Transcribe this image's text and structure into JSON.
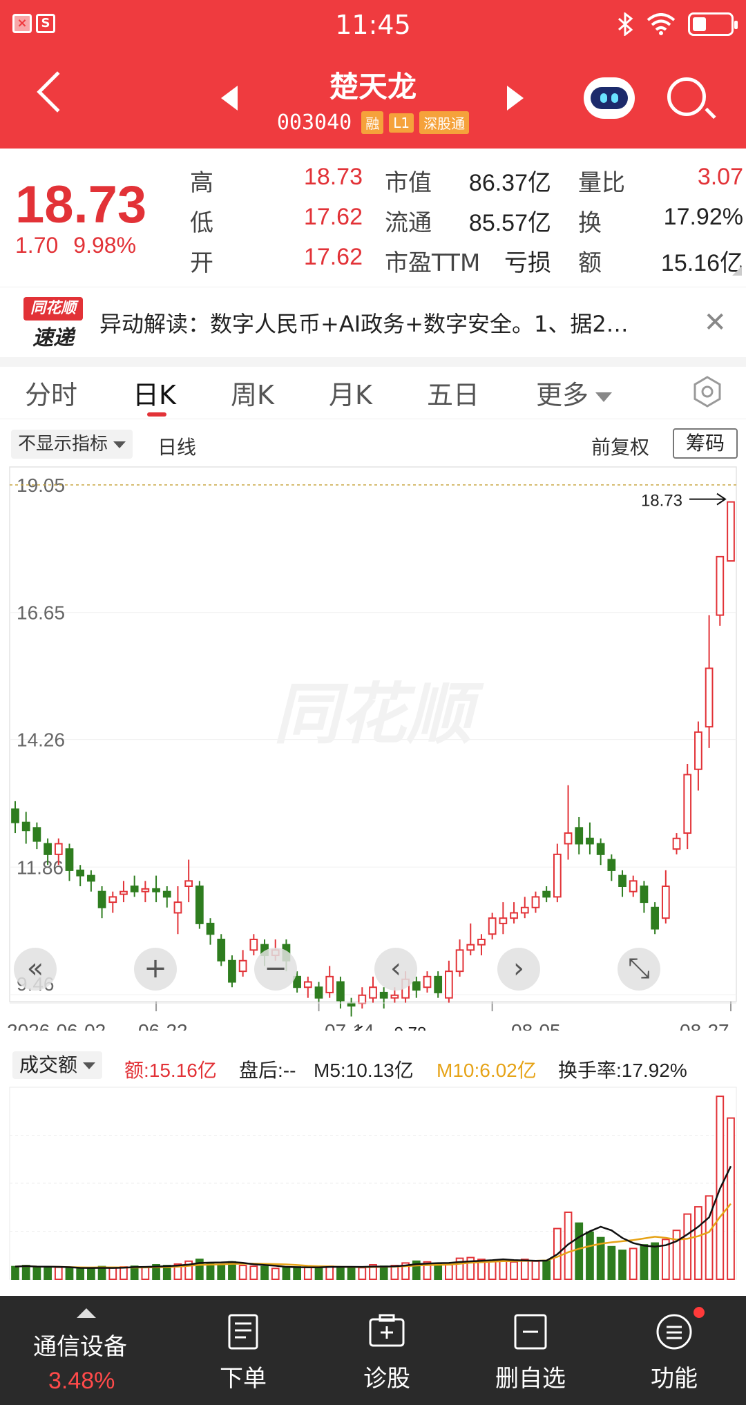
{
  "status_bar": {
    "time": "11:45",
    "app_icons": [
      "×",
      "S"
    ],
    "battery_level": 0.35
  },
  "header": {
    "stock_name": "楚天龙",
    "stock_code": "003040",
    "tags": [
      "融",
      "L1",
      "深股通"
    ]
  },
  "quote": {
    "price": "18.73",
    "change": "1.70",
    "change_pct": "9.98%",
    "rows": [
      [
        {
          "label": "高",
          "value": "18.73"
        },
        {
          "label": "市值",
          "value": "86.37亿"
        },
        {
          "label": "量比",
          "value": "3.07"
        }
      ],
      [
        {
          "label": "低",
          "value": "17.62"
        },
        {
          "label": "流通",
          "value": "85.57亿"
        },
        {
          "label": "换",
          "value": "17.92%"
        }
      ],
      [
        {
          "label": "开",
          "value": "17.62"
        },
        {
          "label": "市盈TTM",
          "value": "亏损"
        },
        {
          "label": "额",
          "value": "15.16亿"
        }
      ]
    ]
  },
  "news": {
    "logo_top": "同花顺",
    "logo_bottom": "速递",
    "text": "异动解读：数字人民币+AI政务+数字安全。1、据2…",
    "close": "✕"
  },
  "tabs": [
    "分时",
    "日K",
    "周K",
    "月K",
    "五日",
    "更多"
  ],
  "active_tab": 1,
  "indicator": {
    "select_label": "不显示指标",
    "period": "日线",
    "adjust": "前复权",
    "chips": "筹码"
  },
  "watermark": "同花顺",
  "chart_data": {
    "type": "candlestick",
    "y_ticks": [
      "19.05",
      "16.65",
      "14.26",
      "11.86",
      "9.46"
    ],
    "x_ticks": [
      "2026-06-02",
      "06-22",
      "07-14",
      "08-05",
      "08-27"
    ],
    "ylim": [
      9.46,
      19.05
    ],
    "high_marker": "18.73",
    "low_marker": "9.78",
    "colors": {
      "up": "#e23237",
      "down": "#2e7d1f",
      "ma5": "#111111",
      "ma10": "#e6a317"
    },
    "candles": [
      [
        12.95,
        12.7,
        13.1,
        12.5
      ],
      [
        12.7,
        12.55,
        12.9,
        12.3
      ],
      [
        12.6,
        12.35,
        12.7,
        12.2
      ],
      [
        12.3,
        12.1,
        12.4,
        11.9
      ],
      [
        12.1,
        12.3,
        12.4,
        11.9
      ],
      [
        12.2,
        11.8,
        12.3,
        11.6
      ],
      [
        11.8,
        11.7,
        11.9,
        11.5
      ],
      [
        11.7,
        11.6,
        11.8,
        11.4
      ],
      [
        11.4,
        11.1,
        11.5,
        10.9
      ],
      [
        11.2,
        11.3,
        11.4,
        11.0
      ],
      [
        11.35,
        11.4,
        11.6,
        11.2
      ],
      [
        11.5,
        11.4,
        11.7,
        11.3
      ],
      [
        11.4,
        11.45,
        11.6,
        11.2
      ],
      [
        11.45,
        11.4,
        11.7,
        11.2
      ],
      [
        11.4,
        11.3,
        11.5,
        11.1
      ],
      [
        11.0,
        11.2,
        11.5,
        10.6
      ],
      [
        11.5,
        11.6,
        12.0,
        11.2
      ],
      [
        11.5,
        10.8,
        11.6,
        10.7
      ],
      [
        10.8,
        10.6,
        10.9,
        10.4
      ],
      [
        10.5,
        10.1,
        10.6,
        10.0
      ],
      [
        10.1,
        9.7,
        10.2,
        9.6
      ],
      [
        9.9,
        10.1,
        10.3,
        9.8
      ],
      [
        10.3,
        10.5,
        10.6,
        10.2
      ],
      [
        10.4,
        10.2,
        10.5,
        10.0
      ],
      [
        10.2,
        10.3,
        10.5,
        10.1
      ],
      [
        10.4,
        10.1,
        10.5,
        9.9
      ],
      [
        9.8,
        9.6,
        9.9,
        9.5
      ],
      [
        9.6,
        9.7,
        9.8,
        9.4
      ],
      [
        9.6,
        9.4,
        9.7,
        9.3
      ],
      [
        9.5,
        9.8,
        10.0,
        9.4
      ],
      [
        9.7,
        9.35,
        9.8,
        9.2
      ],
      [
        9.3,
        9.25,
        9.4,
        9.05
      ],
      [
        9.3,
        9.45,
        9.6,
        9.2
      ],
      [
        9.4,
        9.6,
        9.8,
        9.3
      ],
      [
        9.5,
        9.4,
        9.6,
        9.2
      ],
      [
        9.4,
        9.45,
        9.6,
        9.3
      ],
      [
        9.4,
        9.75,
        9.9,
        9.3
      ],
      [
        9.7,
        9.55,
        9.8,
        9.4
      ],
      [
        9.6,
        9.8,
        9.9,
        9.5
      ],
      [
        9.8,
        9.5,
        9.9,
        9.4
      ],
      [
        9.4,
        9.9,
        10.1,
        9.3
      ],
      [
        9.9,
        10.3,
        10.5,
        9.8
      ],
      [
        10.3,
        10.4,
        10.8,
        10.2
      ],
      [
        10.4,
        10.5,
        10.6,
        10.2
      ],
      [
        10.6,
        10.9,
        11.0,
        10.5
      ],
      [
        10.8,
        10.9,
        11.2,
        10.6
      ],
      [
        10.9,
        11.0,
        11.2,
        10.8
      ],
      [
        11.0,
        11.1,
        11.3,
        10.9
      ],
      [
        11.1,
        11.3,
        11.4,
        11.0
      ],
      [
        11.4,
        11.3,
        11.5,
        11.2
      ],
      [
        11.3,
        12.1,
        12.3,
        11.2
      ],
      [
        12.3,
        12.5,
        13.4,
        12.0
      ],
      [
        12.6,
        12.3,
        12.8,
        12.1
      ],
      [
        12.4,
        12.3,
        12.7,
        12.1
      ],
      [
        12.3,
        12.1,
        12.4,
        11.9
      ],
      [
        12.0,
        11.8,
        12.1,
        11.6
      ],
      [
        11.7,
        11.5,
        11.8,
        11.3
      ],
      [
        11.4,
        11.6,
        11.7,
        11.3
      ],
      [
        11.5,
        11.2,
        11.6,
        11.0
      ],
      [
        11.1,
        10.7,
        11.2,
        10.6
      ],
      [
        10.9,
        11.5,
        11.8,
        10.8
      ],
      [
        12.2,
        12.4,
        12.5,
        12.1
      ],
      [
        12.5,
        13.6,
        13.8,
        12.2
      ],
      [
        13.7,
        14.4,
        14.6,
        13.3
      ],
      [
        14.5,
        15.6,
        16.6,
        14.1
      ],
      [
        16.6,
        17.7,
        17.7,
        16.4
      ],
      [
        17.62,
        18.73,
        18.73,
        17.62
      ]
    ],
    "volume": {
      "header": {
        "select": "成交额",
        "amount": "额:15.16亿",
        "after_hours": "盘后:--",
        "m5": "M5:10.13亿",
        "m10": "M10:6.02亿",
        "turnover": "换手率:17.92%"
      },
      "values": [
        0.35,
        0.38,
        0.32,
        0.34,
        0.33,
        0.3,
        0.28,
        0.31,
        0.35,
        0.32,
        0.34,
        0.36,
        0.33,
        0.4,
        0.38,
        0.42,
        0.5,
        0.55,
        0.45,
        0.4,
        0.48,
        0.38,
        0.36,
        0.35,
        0.3,
        0.32,
        0.34,
        0.33,
        0.35,
        0.36,
        0.34,
        0.33,
        0.32,
        0.4,
        0.36,
        0.38,
        0.45,
        0.5,
        0.48,
        0.42,
        0.4,
        0.58,
        0.6,
        0.55,
        0.5,
        0.52,
        0.48,
        0.55,
        0.5,
        0.52,
        1.4,
        1.85,
        1.55,
        1.3,
        1.15,
        0.9,
        0.8,
        0.85,
        0.95,
        1.0,
        1.1,
        1.35,
        1.8,
        2.0,
        2.3,
        5.05,
        4.45
      ],
      "ymax": 5.3
    }
  },
  "chart_controls": [
    "«",
    "+",
    "−",
    "‹",
    "›",
    "⤡"
  ],
  "bottom_nav": {
    "sector_name": "通信设备",
    "sector_change": "3.48%",
    "items": [
      {
        "label": "下单",
        "icon": "order-icon"
      },
      {
        "label": "诊股",
        "icon": "diagnose-icon"
      },
      {
        "label": "删自选",
        "icon": "remove-favorite-icon"
      },
      {
        "label": "功能",
        "icon": "menu-icon"
      }
    ]
  }
}
